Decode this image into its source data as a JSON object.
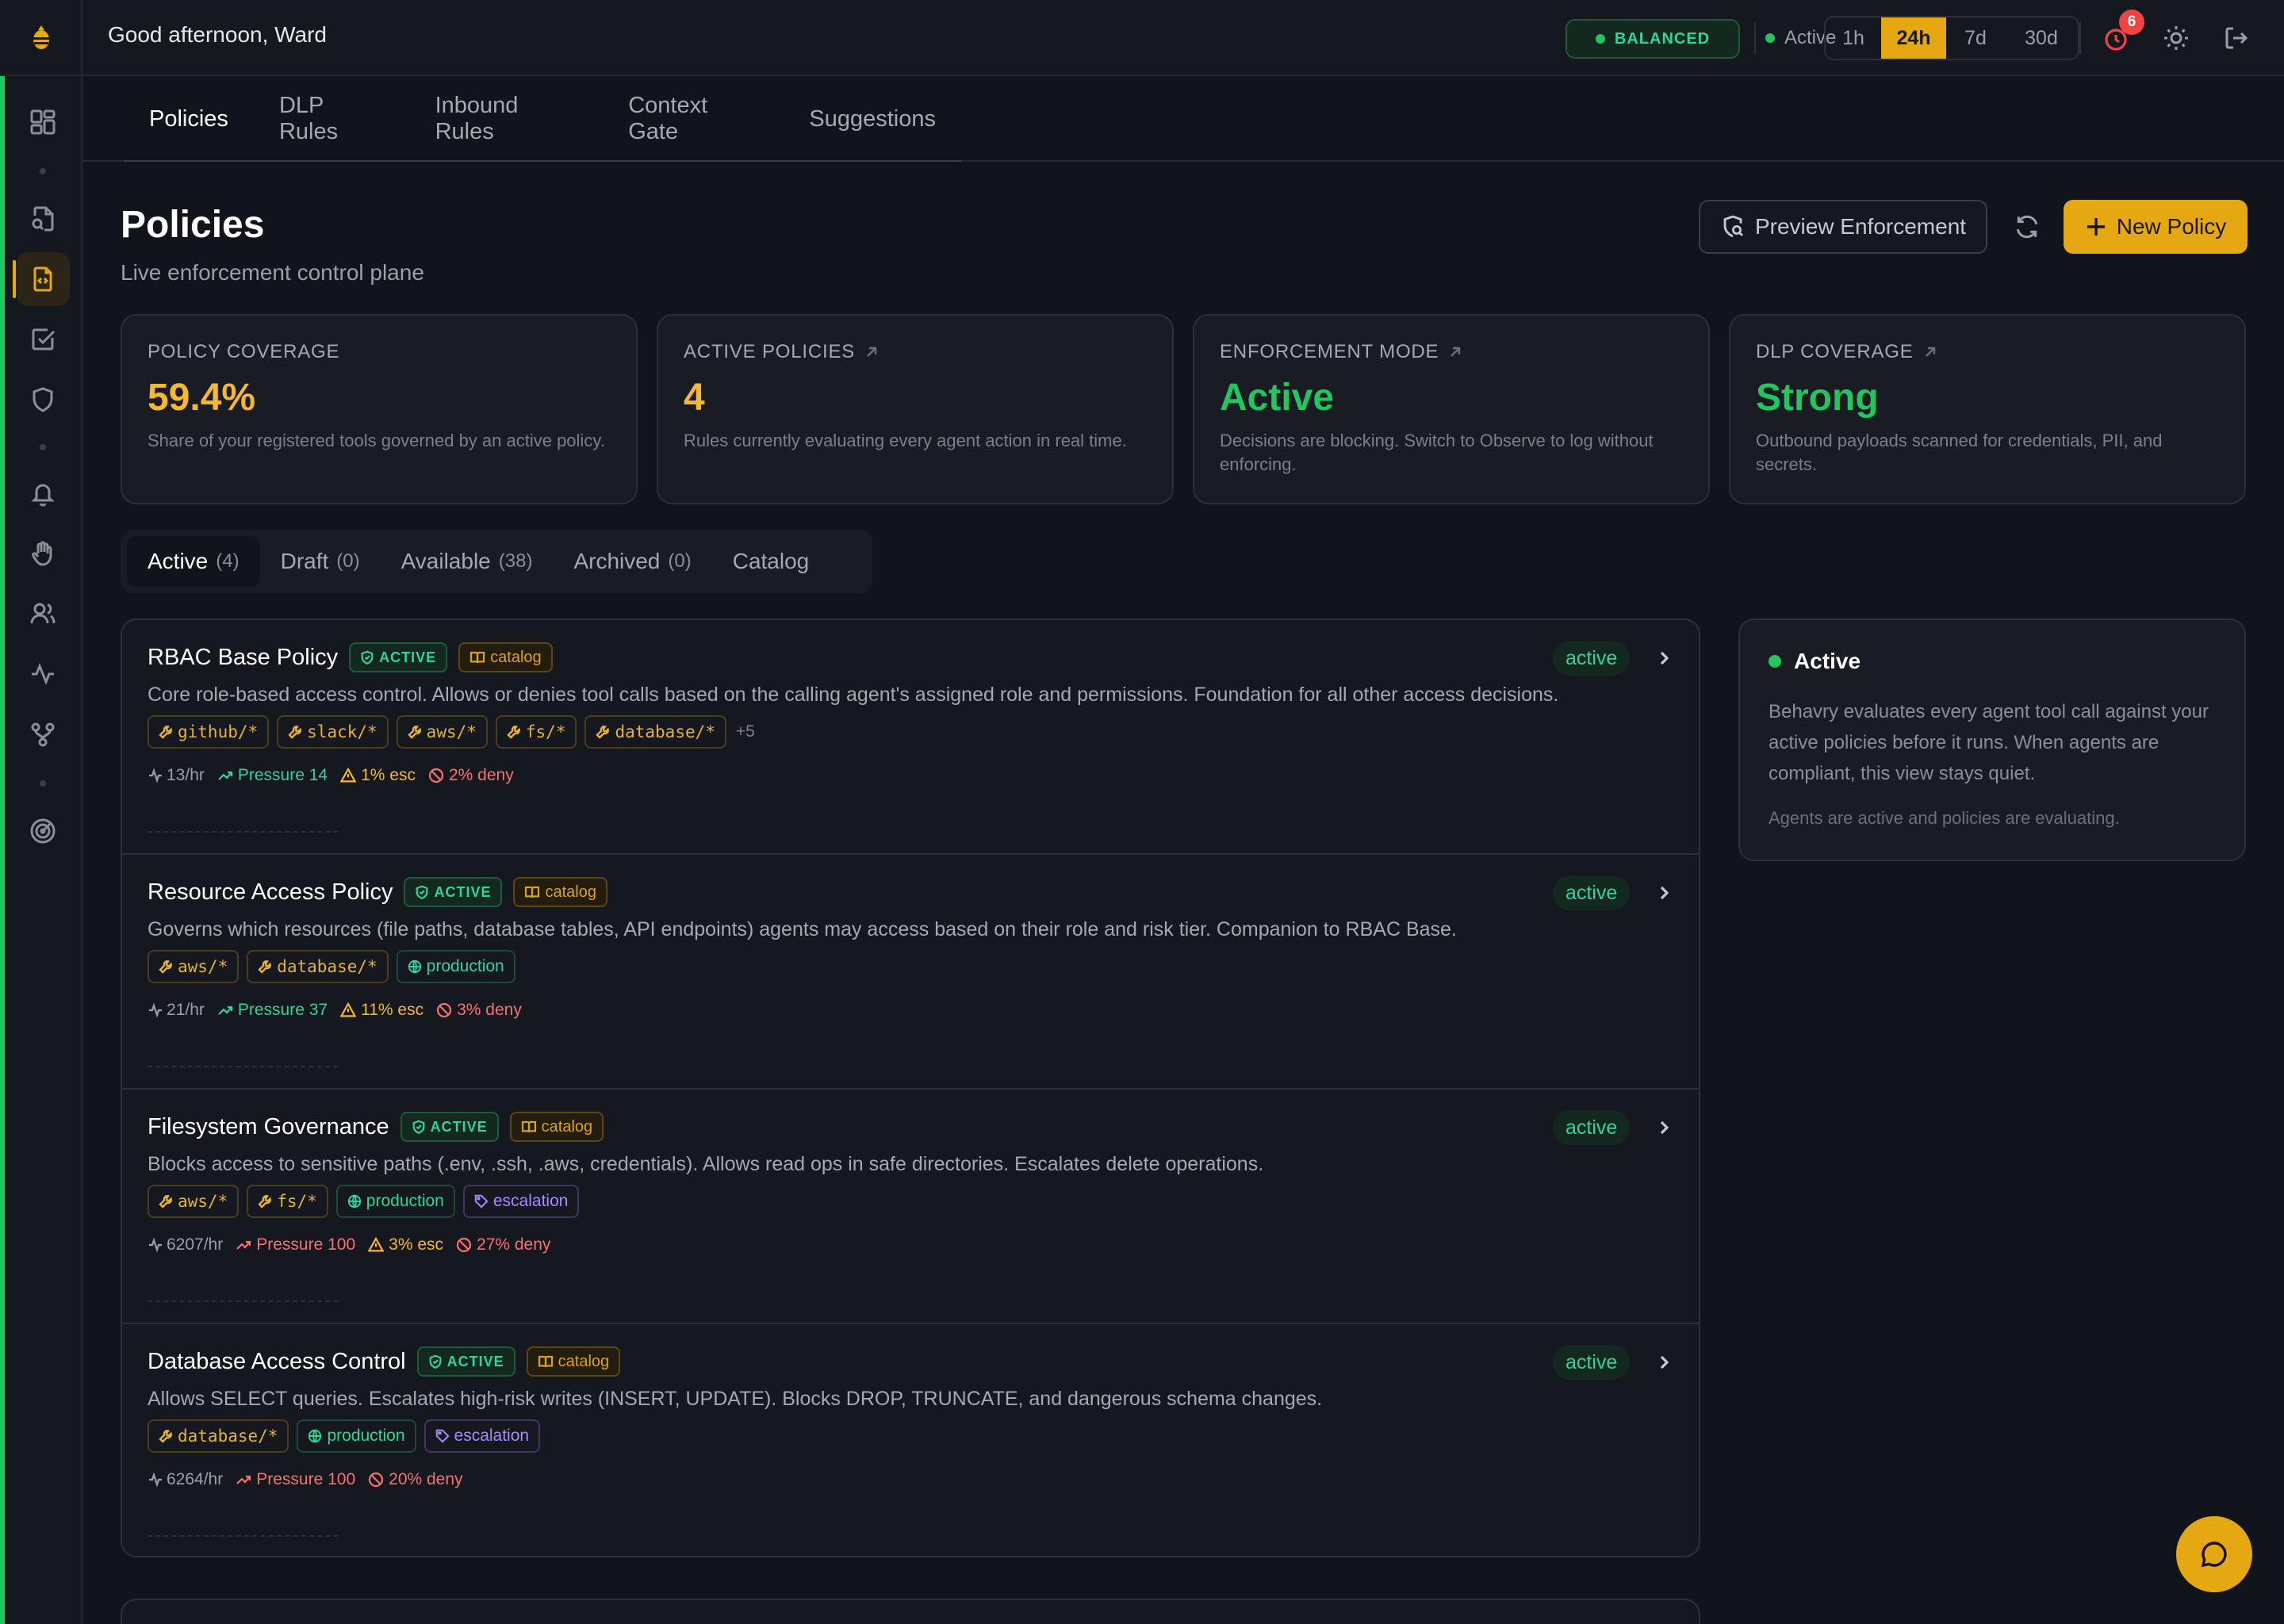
{
  "topbar": {
    "greeting": "Good afternoon, Ward",
    "mode_badge": "BALANCED",
    "status": "Active",
    "ranges": [
      "1h",
      "24h",
      "7d",
      "30d"
    ],
    "selected_range": "24h",
    "notification_count": "6"
  },
  "subtabs": [
    "Policies",
    "DLP Rules",
    "Inbound Rules",
    "Context Gate",
    "Suggestions"
  ],
  "page": {
    "title": "Policies",
    "subtitle": "Live enforcement control plane",
    "preview_button": "Preview Enforcement",
    "new_button": "New Policy"
  },
  "stats": [
    {
      "label": "POLICY COVERAGE",
      "value": "59.4%",
      "desc": "Share of your registered tools governed by an active policy.",
      "color": "#f5b82e"
    },
    {
      "label": "ACTIVE POLICIES",
      "value": "4",
      "desc": "Rules currently evaluating every agent action in real time.",
      "color": "#f5b82e"
    },
    {
      "label": "ENFORCEMENT MODE",
      "value": "Active",
      "desc": "Decisions are blocking. Switch to Observe to log without enforcing.",
      "color": "#22c55e"
    },
    {
      "label": "DLP COVERAGE",
      "value": "Strong",
      "desc": "Outbound payloads scanned for credentials, PII, and secrets.",
      "color": "#22c55e"
    }
  ],
  "list_tabs": [
    {
      "label": "Active",
      "count": "(4)"
    },
    {
      "label": "Draft",
      "count": "(0)"
    },
    {
      "label": "Available",
      "count": "(38)"
    },
    {
      "label": "Archived",
      "count": "(0)"
    },
    {
      "label": "Catalog",
      "count": ""
    }
  ],
  "policy_badges": {
    "active": "ACTIVE",
    "catalog": "catalog",
    "status": "active"
  },
  "policies": [
    {
      "name": "RBAC Base Policy",
      "desc": "Core role-based access control. Allows or denies tool calls based on the calling agent's assigned role and permissions. Foundation for all other access decisions.",
      "tools": [
        "github/*",
        "slack/*",
        "aws/*",
        "fs/*",
        "database/*"
      ],
      "more": "+5",
      "rate": "13/hr",
      "pressure": "Pressure 14",
      "esc": "1% esc",
      "deny": "2% deny",
      "pressure_color": "#34d399"
    },
    {
      "name": "Resource Access Policy",
      "desc": "Governs which resources (file paths, database tables, API endpoints) agents may access based on their role and risk tier. Companion to RBAC Base.",
      "tools": [
        "aws/*",
        "database/*"
      ],
      "envs": [
        "production"
      ],
      "rate": "21/hr",
      "pressure": "Pressure 37",
      "esc": "11% esc",
      "deny": "3% deny",
      "pressure_color": "#34d399"
    },
    {
      "name": "Filesystem Governance",
      "desc": "Blocks access to sensitive paths (.env, .ssh, .aws, credentials). Allows read ops in safe directories. Escalates delete operations.",
      "tools": [
        "aws/*",
        "fs/*"
      ],
      "envs": [
        "production"
      ],
      "labels": [
        "escalation"
      ],
      "rate": "6207/hr",
      "pressure": "Pressure 100",
      "esc": "3% esc",
      "deny": "27% deny",
      "pressure_color": "#f87171"
    },
    {
      "name": "Database Access Control",
      "desc": "Allows SELECT queries. Escalates high-risk writes (INSERT, UPDATE). Blocks DROP, TRUNCATE, and dangerous schema changes.",
      "tools": [
        "database/*"
      ],
      "envs": [
        "production"
      ],
      "labels": [
        "escalation"
      ],
      "rate": "6264/hr",
      "pressure": "Pressure 100",
      "deny": "20% deny",
      "pressure_color": "#f87171"
    }
  ],
  "side_panel": {
    "title": "Active",
    "body": "Behavry evaluates every agent tool call against your active policies before it runs. When agents are compliant, this view stays quiet.",
    "footer": "Agents are active and policies are evaluating."
  }
}
